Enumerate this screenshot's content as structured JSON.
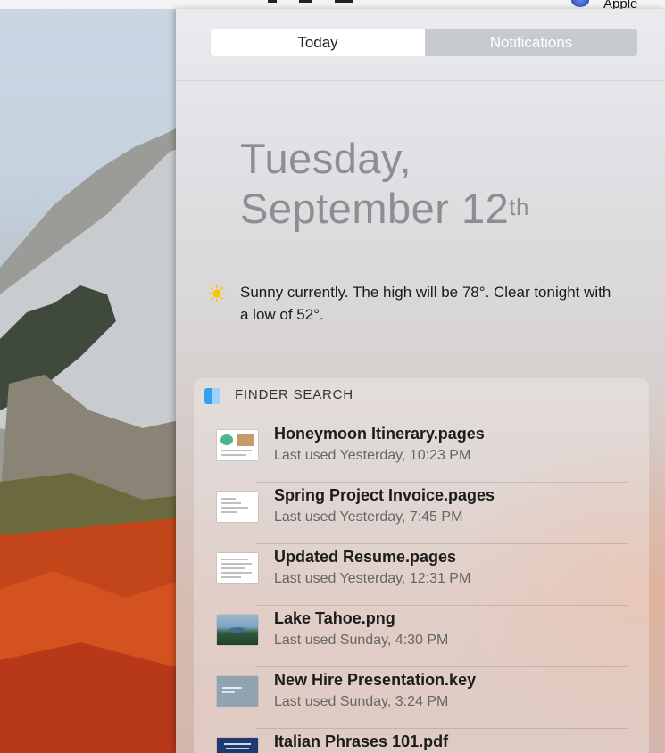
{
  "menubar": {
    "account_label": "Apple"
  },
  "notification_center": {
    "tabs": [
      {
        "label": "Today",
        "selected": true
      },
      {
        "label": "Notifications",
        "selected": false
      }
    ],
    "date": {
      "weekday": "Tuesday,",
      "month_day": "September 12",
      "ordinal_suffix": "th"
    },
    "weather": {
      "icon": "sun-icon",
      "text": "Sunny currently. The high will be 78°.  Clear tonight with a low of 52°."
    },
    "finder_search": {
      "title": "FINDER SEARCH",
      "icon": "finder-icon",
      "results": [
        {
          "name": "Honeymoon Itinerary.pages",
          "meta": "Last used Yesterday, 10:23 PM",
          "thumb": "pages-photo-thumb"
        },
        {
          "name": "Spring Project Invoice.pages",
          "meta": "Last used Yesterday, 7:45 PM",
          "thumb": "document-thumb"
        },
        {
          "name": "Updated Resume.pages",
          "meta": "Last used Yesterday, 12:31 PM",
          "thumb": "document-thumb"
        },
        {
          "name": "Lake Tahoe.png",
          "meta": "Last used Sunday, 4:30 PM",
          "thumb": "landscape-thumb"
        },
        {
          "name": "New Hire Presentation.key",
          "meta": "Last used Sunday, 3:24 PM",
          "thumb": "keynote-thumb"
        },
        {
          "name": "Italian Phrases 101.pdf",
          "meta": "",
          "thumb": "pdf-thumb"
        }
      ]
    }
  },
  "colors": {
    "accent_blue": "#1f3fb5",
    "sun": "#f7c600",
    "finder_blue": "#37a0ee"
  }
}
